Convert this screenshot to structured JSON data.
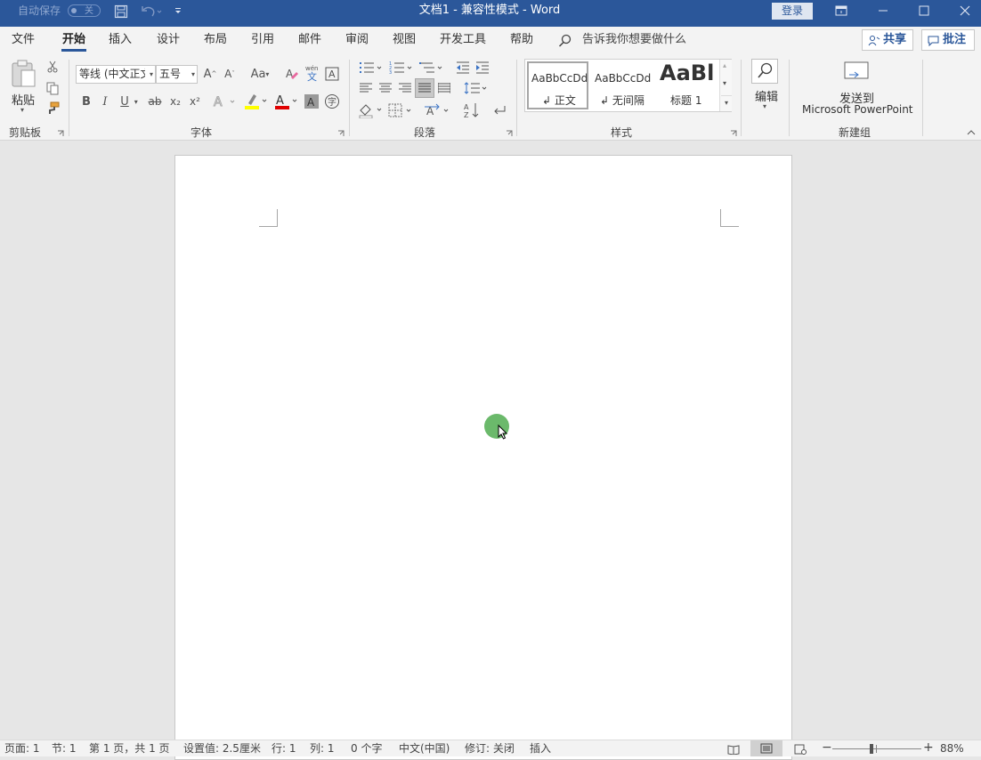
{
  "titlebar": {
    "autosave": "自动保存",
    "toggle": "关",
    "title": "文档1  -  兼容性模式  -  Word",
    "login": "登录"
  },
  "tabs": [
    "文件",
    "开始",
    "插入",
    "设计",
    "布局",
    "引用",
    "邮件",
    "审阅",
    "视图",
    "开发工具",
    "帮助"
  ],
  "tellme": "告诉我你想要做什么",
  "share": "共享",
  "comment": "批注",
  "clipboard": {
    "paste": "粘贴",
    "group": "剪贴板"
  },
  "font": {
    "name": "等线 (中文正文)",
    "size": "五号",
    "bold": "B",
    "italic": "I",
    "underline": "U",
    "strike": "ab",
    "sub": "x₂",
    "sup": "x²",
    "aa": "Aa",
    "group": "字体"
  },
  "paragraph": {
    "group": "段落"
  },
  "styles": {
    "items": [
      {
        "preview": "AaBbCcDd",
        "label": "↲ 正文"
      },
      {
        "preview": "AaBbCcDd",
        "label": "↲ 无间隔"
      },
      {
        "preview": "AaBl",
        "label": "标题 1"
      }
    ],
    "group": "样式"
  },
  "editing": {
    "label": "编辑"
  },
  "newgroup": {
    "line1": "发送到",
    "line2": "Microsoft PowerPoint",
    "group": "新建组"
  },
  "status": {
    "page": "页面: 1",
    "section": "节: 1",
    "pages": "第 1 页，共 1 页",
    "setting": "设置值: 2.5厘米",
    "row": "行: 1",
    "col": "列: 1",
    "words": "0 个字",
    "lang": "中文(中国)",
    "track": "修订: 关闭",
    "insert": "插入",
    "zoom": "88%"
  },
  "colors": {
    "accent": "#2b579a",
    "highlight": "#ffff00",
    "font_color": "#e00000",
    "cursor": "#6bb96b"
  }
}
